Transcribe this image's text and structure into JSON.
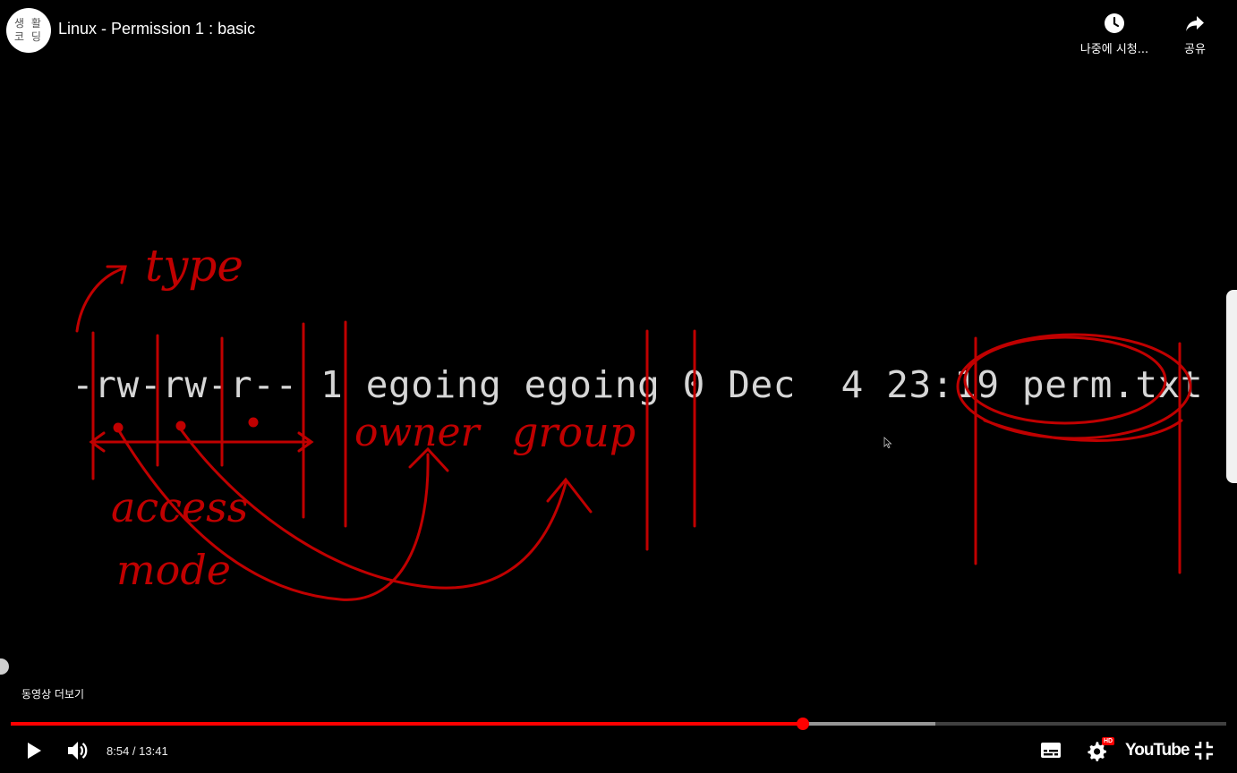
{
  "header": {
    "channel_avatar_text": "생 활\n코 딩",
    "title": "Linux - Permission 1 : basic",
    "watch_later_label": "나중에 시청...",
    "share_label": "공유"
  },
  "video": {
    "terminal_text": "-rw-rw-r-- 1 egoing egoing 0 Dec  4 23:19 perm.txt",
    "annotations": {
      "type": "type",
      "access": "access",
      "mode": "mode",
      "owner": "owner",
      "group": "group"
    },
    "ink_color": "#c00000"
  },
  "overlay": {
    "more_videos_label": "동영상 더보기"
  },
  "controls": {
    "current_time": "8:54",
    "duration": "13:41",
    "time_text": "8:54 / 13:41",
    "played_fraction": 0.652,
    "buffered_fraction": 0.761,
    "hd_badge": "HD",
    "logo_text": "YouTube",
    "progress_color": "#ff0000"
  },
  "icons": {
    "play": "play-icon",
    "volume": "volume-icon",
    "subtitles": "subtitles-icon",
    "settings": "gear-icon",
    "exit_fullscreen": "exit-fullscreen-icon",
    "clock": "clock-icon",
    "share": "share-icon"
  }
}
